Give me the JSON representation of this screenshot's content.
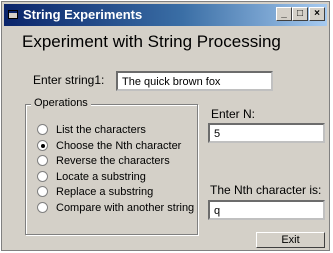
{
  "window": {
    "title": "String Experiments",
    "controls": {
      "minimize": "_",
      "maximize": "□",
      "close": "×"
    }
  },
  "heading": "Experiment with String Processing",
  "input1": {
    "label": "Enter string1:",
    "value": "The quick brown fox"
  },
  "operations": {
    "title": "Operations",
    "selected_index": 1,
    "items": [
      "List the characters",
      "Choose the Nth character",
      "Reverse the characters",
      "Locate a substring",
      "Replace a substring",
      "Compare with another string"
    ]
  },
  "n_field": {
    "label": "Enter N:",
    "value": "5"
  },
  "result_field": {
    "label": "The Nth character is:",
    "value": "q"
  },
  "exit_button": "Exit"
}
